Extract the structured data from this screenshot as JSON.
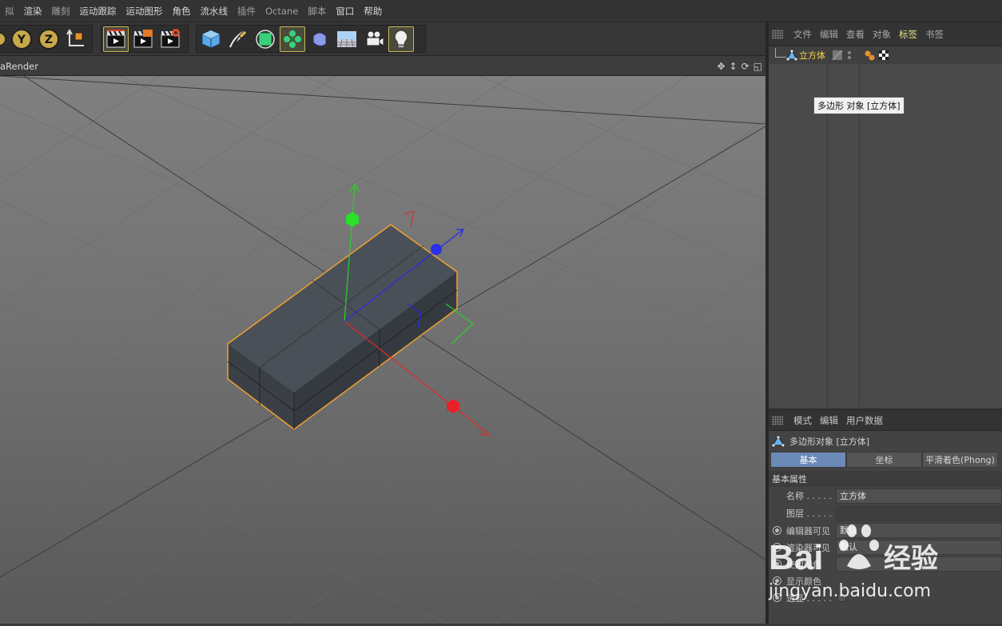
{
  "menubar": {
    "items": [
      {
        "label": "拟",
        "dim": true
      },
      {
        "label": "渲染",
        "dim": false
      },
      {
        "label": "雕刻",
        "dim": true
      },
      {
        "label": "运动跟踪",
        "dim": false
      },
      {
        "label": "运动图形",
        "dim": false
      },
      {
        "label": "角色",
        "dim": false
      },
      {
        "label": "流水线",
        "dim": false
      },
      {
        "label": "插件",
        "dim": true
      },
      {
        "label": "Octane",
        "dim": true
      },
      {
        "label": "脚本",
        "dim": true
      },
      {
        "label": "窗口",
        "dim": false
      },
      {
        "label": "帮助",
        "dim": false
      }
    ]
  },
  "toolbar": {
    "axis_buttons": [
      "Y",
      "Z"
    ],
    "tools": [
      "coordinate-system",
      "render-view",
      "render-picture-viewer",
      "render-settings",
      "cube",
      "pen",
      "subdivision",
      "cloner",
      "deformer",
      "floor",
      "camera",
      "light"
    ]
  },
  "viewport": {
    "title": "aRender",
    "nav_icons": [
      "move-view-icon",
      "zoom-view-icon",
      "rotate-view-icon",
      "maximize-view-icon"
    ],
    "axis_colors": {
      "x": "#e02a2a",
      "y": "#2be02b",
      "z": "#2a2ae6"
    },
    "selection_color": "#f0a030"
  },
  "object_manager": {
    "menu": [
      {
        "label": "文件",
        "active": false
      },
      {
        "label": "编辑",
        "active": false
      },
      {
        "label": "查看",
        "active": false
      },
      {
        "label": "对象",
        "active": false
      },
      {
        "label": "标签",
        "active": true
      },
      {
        "label": "书签",
        "active": false
      }
    ],
    "object": {
      "name": "立方体"
    },
    "tooltip": "多边形 对象 [立方体]"
  },
  "attribute_manager": {
    "menu": [
      "模式",
      "编辑",
      "用户数据"
    ],
    "title": "多边形对象 [立方体]",
    "tabs": [
      {
        "label": "基本",
        "active": true
      },
      {
        "label": "坐标",
        "active": false
      },
      {
        "label": "平滑着色(Phong)",
        "active": false
      }
    ],
    "section": "基本属性",
    "fields": [
      {
        "label": "名称 . . . . .",
        "value": "立方体"
      },
      {
        "label": "图层 . . . . .",
        "value": ""
      }
    ],
    "radio_rows": [
      {
        "label": "编辑器可见",
        "value": "默认"
      },
      {
        "label": "渲染器可见",
        "value": "默认"
      },
      {
        "label": "使用颜色",
        "value": ""
      },
      {
        "label": "显示颜色",
        "value": ""
      },
      {
        "label": "透显 . . . . .",
        "value": ""
      }
    ]
  },
  "watermark": {
    "brand_text": "Bai",
    "brand_cn": "经验",
    "url": "jingyan.baidu.com"
  }
}
